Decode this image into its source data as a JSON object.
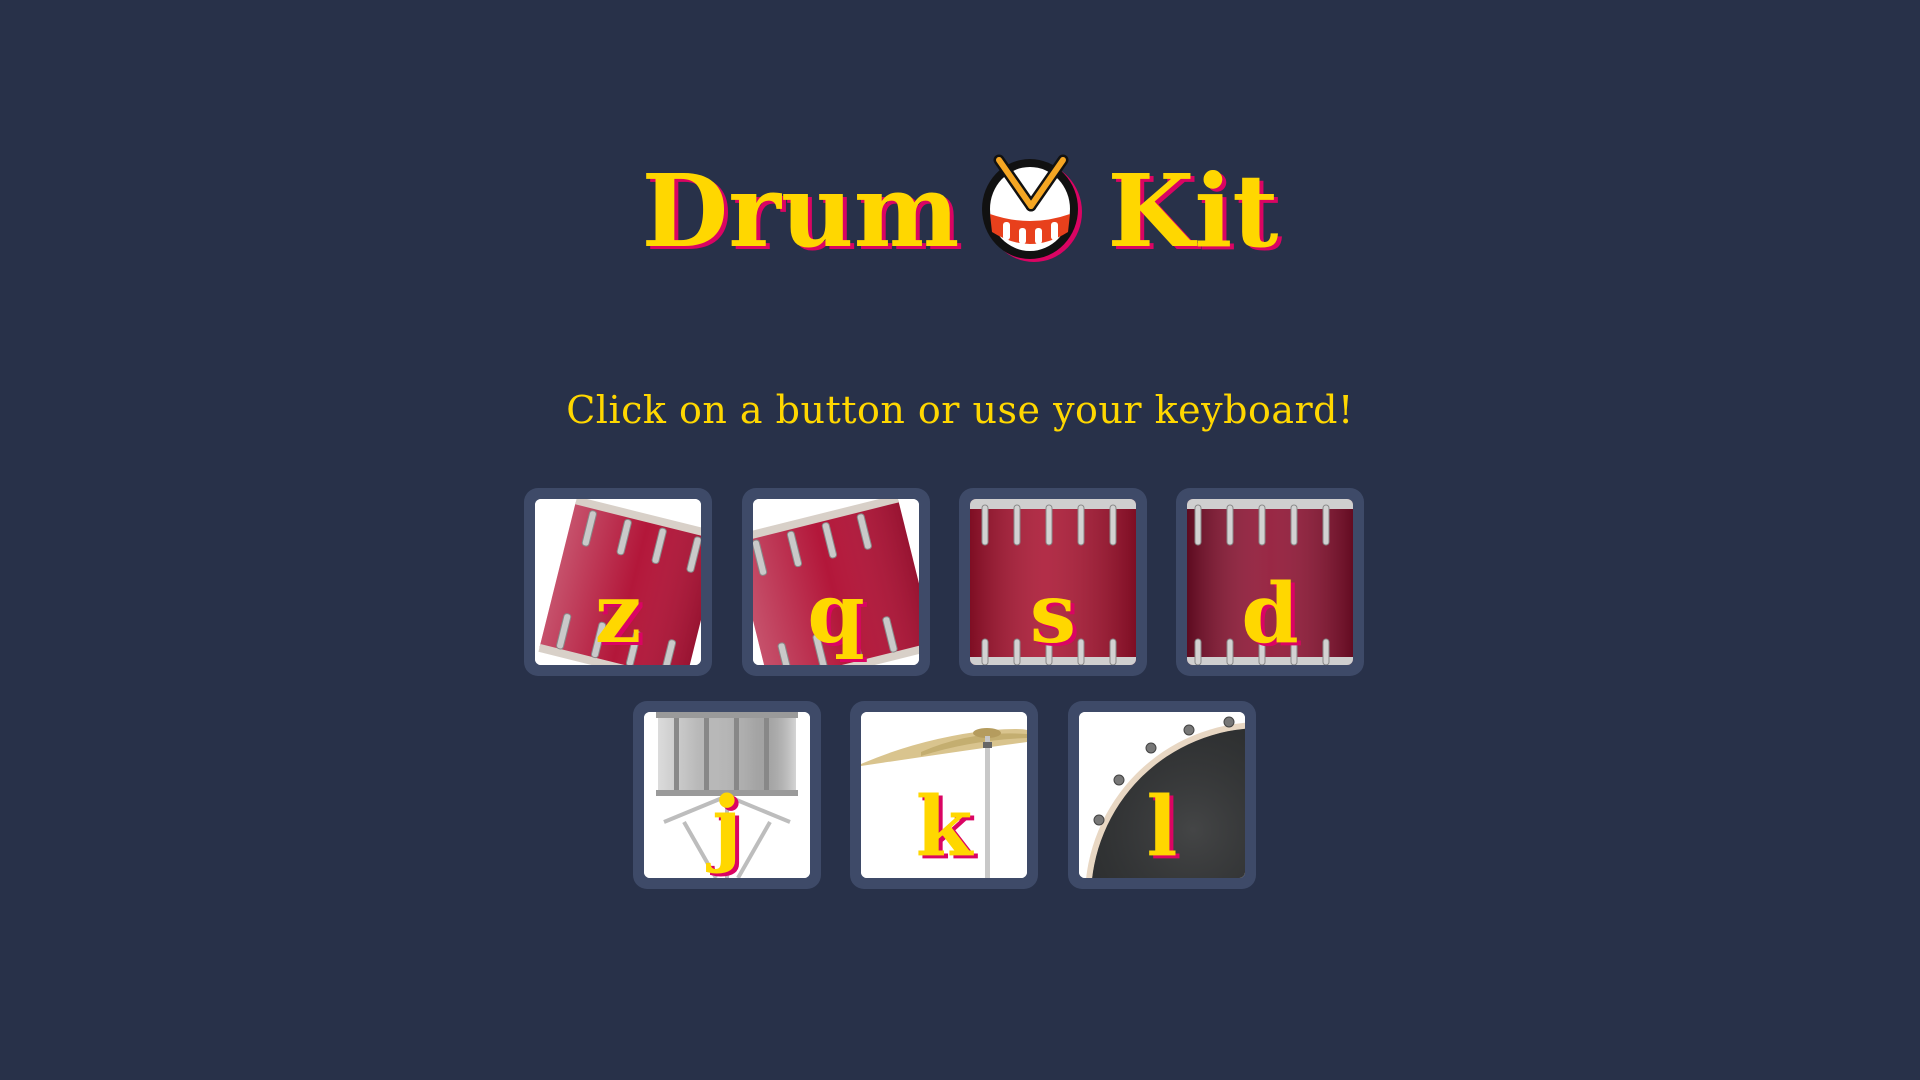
{
  "header": {
    "title_before": "Drum",
    "title_after": "Kit",
    "emoji_icon": "drum-emoji-icon"
  },
  "instruction": "Click on a button or use your keyboard!",
  "colors": {
    "background": "#283149",
    "text": "#FFD700",
    "shadow": "#DA0463",
    "button_frame": "#3e4a68"
  },
  "drums": [
    {
      "key": "z",
      "sound": "tom-1",
      "image": "tilted-red-tom"
    },
    {
      "key": "q",
      "sound": "tom-2",
      "image": "tilted-red-tom"
    },
    {
      "key": "s",
      "sound": "tom-3",
      "image": "red-floor-tom"
    },
    {
      "key": "d",
      "sound": "tom-4",
      "image": "red-floor-tom"
    },
    {
      "key": "j",
      "sound": "snare",
      "image": "silver-snare-on-stand"
    },
    {
      "key": "k",
      "sound": "crash",
      "image": "crash-cymbal"
    },
    {
      "key": "l",
      "sound": "kick-bass",
      "image": "bass-drum-head"
    }
  ]
}
